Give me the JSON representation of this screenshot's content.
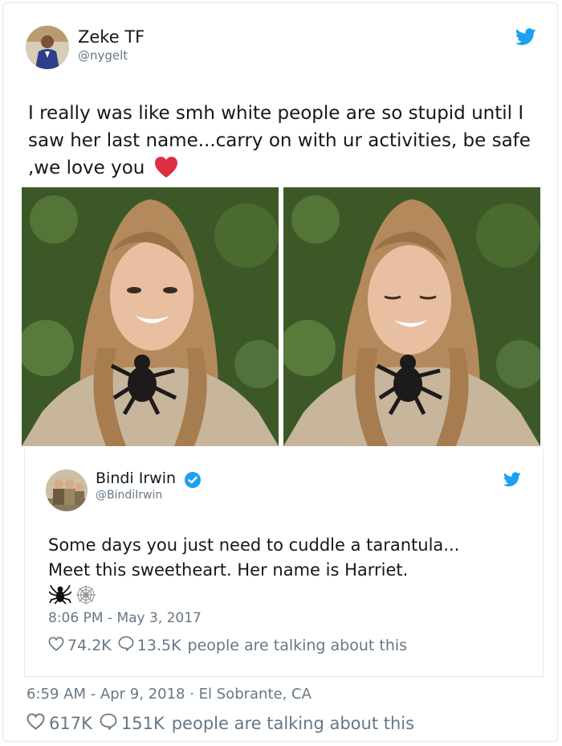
{
  "tweet": {
    "author_name": "Zeke TF",
    "author_handle": "@nygelt",
    "text": "I really was like smh white people are so stupid until I saw her last name...carry on with ur activities, be safe ,we love you",
    "heart_emoji": "red-heart-icon",
    "timestamp": "6:59 AM - Apr 9, 2018 · El Sobrante, CA",
    "likes": "617K",
    "replies": "151K",
    "talking_label": "people are talking about this"
  },
  "quoted": {
    "author_name": "Bindi Irwin",
    "author_handle": "@BindiIrwin",
    "line1": "Some days you just need to cuddle a tarantula...",
    "line2": "Meet this sweetheart. Her name is Harriet.",
    "emojis": [
      "spider-icon",
      "spider-web-icon"
    ],
    "timestamp": "8:06 PM - May 3, 2017",
    "likes": "74.2K",
    "replies": "13.5K",
    "talking_label": "people are talking about this"
  },
  "colors": {
    "twitter_blue": "#1da1f2",
    "meta_gray": "#657786",
    "text": "#14171a",
    "heart_red": "#e0245e"
  }
}
